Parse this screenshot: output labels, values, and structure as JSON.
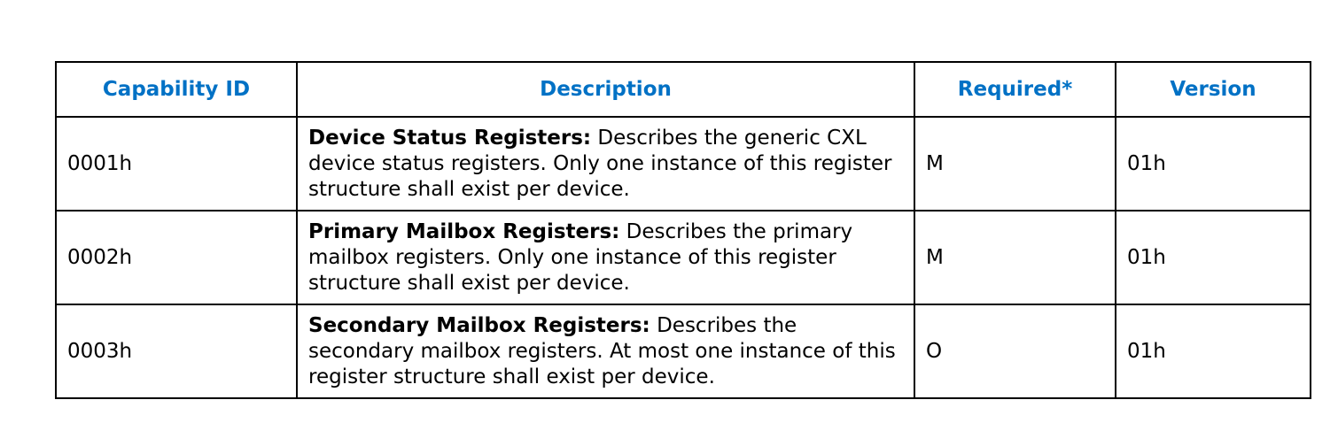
{
  "table": {
    "headers": {
      "capability_id": "Capability ID",
      "description": "Description",
      "required": "Required*",
      "version": "Version"
    },
    "rows": [
      {
        "capability_id": "0001h",
        "term": "Device Status Registers:",
        "description": " Describes the generic CXL device status registers. Only one instance of this register structure shall exist per device.",
        "required": "M",
        "version": "01h"
      },
      {
        "capability_id": "0002h",
        "term": "Primary Mailbox Registers:",
        "description": " Describes the primary mailbox registers. Only one instance of this register structure shall exist per device.",
        "required": "M",
        "version": "01h"
      },
      {
        "capability_id": "0003h",
        "term": "Secondary Mailbox Registers:",
        "description": " Describes the secondary mailbox registers. At most one instance of this register structure shall exist per device.",
        "required": "O",
        "version": "01h"
      }
    ]
  }
}
